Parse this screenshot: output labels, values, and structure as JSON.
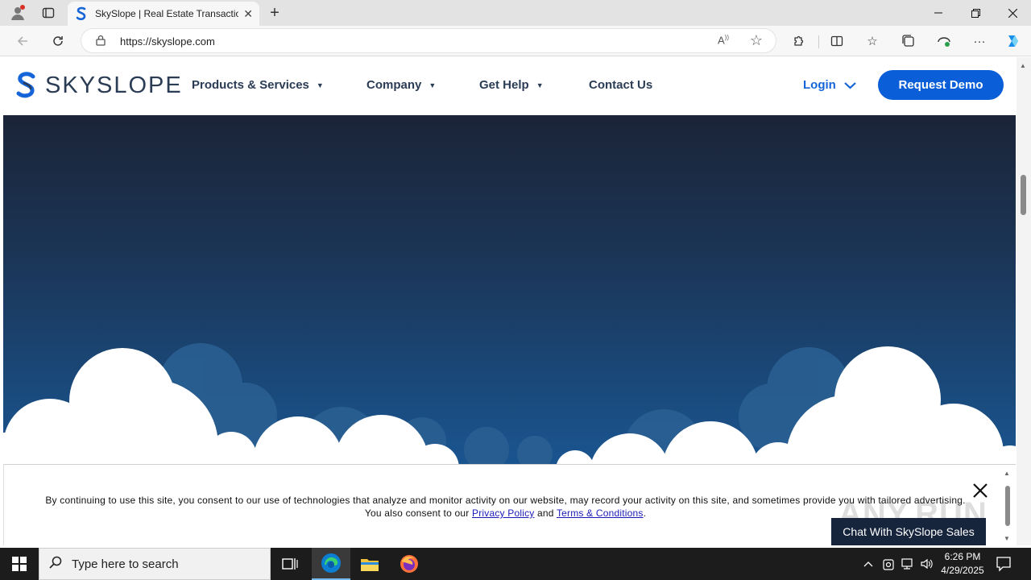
{
  "browser": {
    "tab_title": "SkySlope | Real Estate Transaction",
    "url": "https://skyslope.com"
  },
  "site": {
    "logo_text": "SKYSLOPE",
    "nav": [
      {
        "label": "Products & Services"
      },
      {
        "label": "Company"
      },
      {
        "label": "Get Help"
      },
      {
        "label": "Contact Us"
      }
    ],
    "login_label": "Login",
    "demo_label": "Request Demo",
    "brand_blue": "#0a5fd8"
  },
  "cookie_banner": {
    "text_part1": "By continuing to use this site, you consent to our use of technologies that analyze and monitor activity on our website, may record your activity on this site, and sometimes provide you with tailored advertising. You also consent to our",
    "privacy_link": "Privacy Policy",
    "and_word": "and",
    "terms_link": "Terms & Conditions",
    "end_period": ".",
    "chat_label": "Chat With SkySlope Sales",
    "watermark": "ANY.RUN"
  },
  "taskbar": {
    "search_placeholder": "Type here to search",
    "time": "6:26 PM",
    "date": "4/29/2025"
  }
}
